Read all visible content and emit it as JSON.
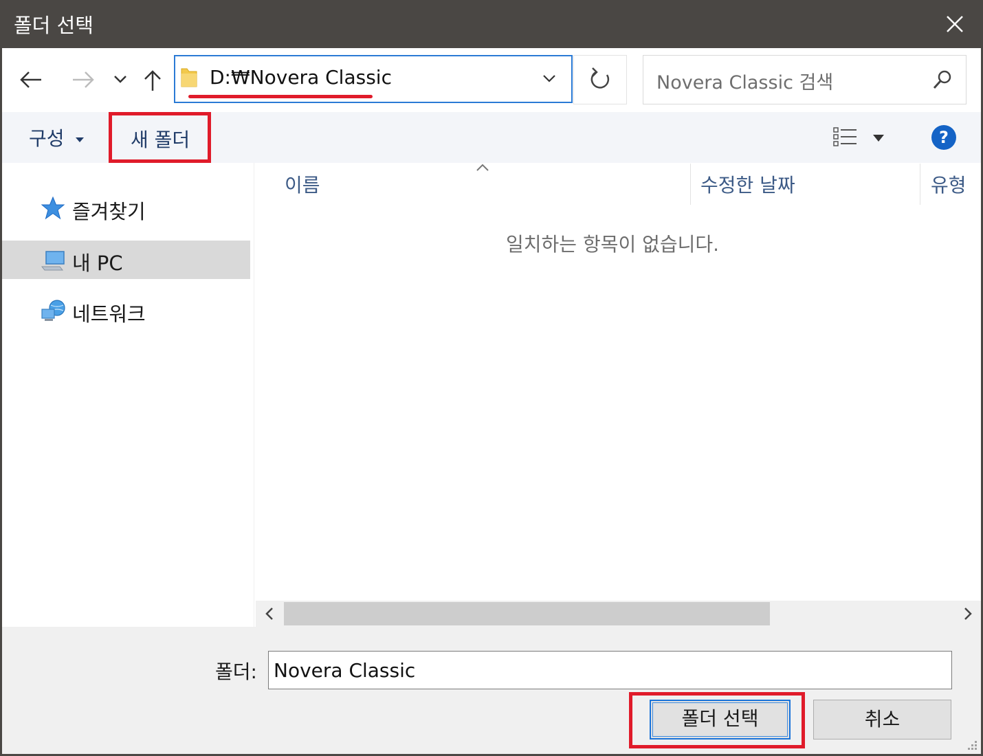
{
  "window": {
    "title": "폴더 선택"
  },
  "address_bar": {
    "path": "D:₩Novera Classic"
  },
  "search": {
    "placeholder": "Novera Classic 검색"
  },
  "toolbar": {
    "organize_label": "구성",
    "new_folder_label": "새 폴더"
  },
  "nav_pane": {
    "items": [
      {
        "label": "즐겨찾기",
        "icon": "star-icon"
      },
      {
        "label": "내 PC",
        "icon": "computer-icon",
        "selected": true
      },
      {
        "label": "네트워크",
        "icon": "network-icon"
      }
    ]
  },
  "file_list": {
    "columns": [
      "이름",
      "수정한 날짜",
      "유형"
    ],
    "empty_message": "일치하는 항목이 없습니다."
  },
  "footer": {
    "folder_label": "폴더:",
    "folder_value": "Novera Classic",
    "select_button_label": "폴더 선택",
    "cancel_button_label": "취소"
  },
  "colors": {
    "title_bar": "#4a4744",
    "accent": "#2a7ad5",
    "highlight_annotation": "#e01b2a"
  }
}
